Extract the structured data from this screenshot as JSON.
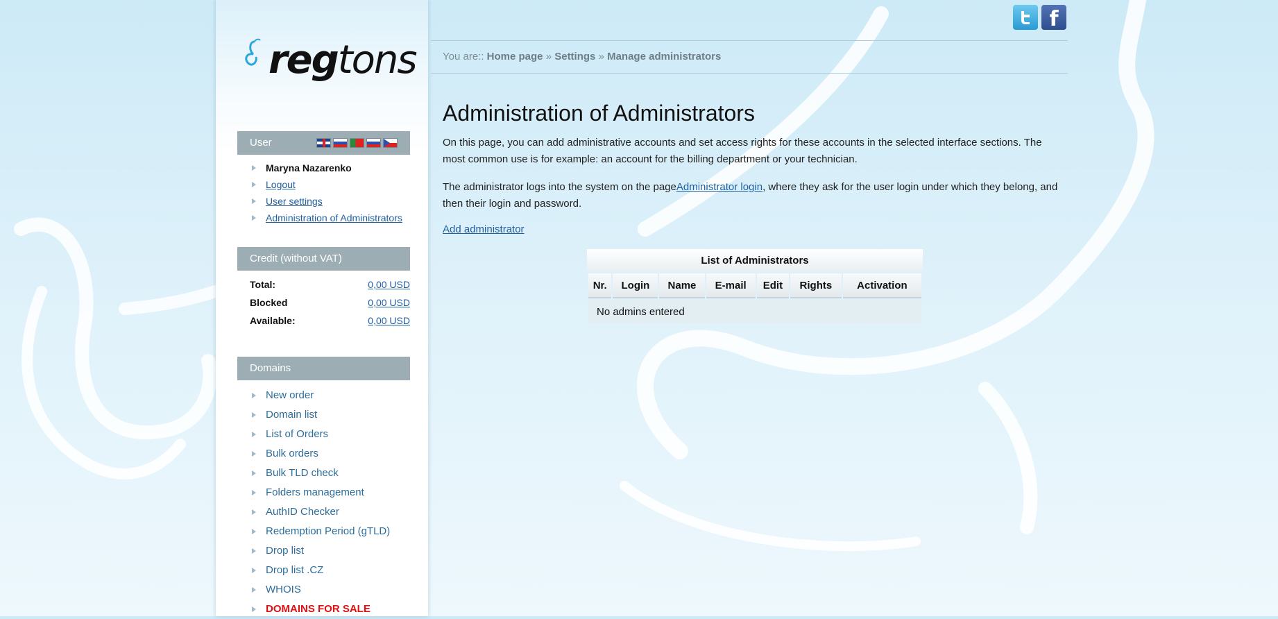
{
  "brand": {
    "logo_bold": "reg",
    "logo_light": "tons"
  },
  "social": {
    "twitter": "twitter-icon",
    "facebook": "facebook-icon",
    "facebook_glyph": "f"
  },
  "breadcrumb": {
    "prefix": "You are:: ",
    "items": [
      "Home page",
      "Settings",
      "Manage administrators"
    ],
    "separator": " » "
  },
  "sidebar": {
    "user_panel": {
      "title": "User",
      "languages": [
        "en",
        "ru",
        "pt",
        "sk",
        "cz"
      ],
      "name": "Maryna Nazarenko",
      "links": [
        "Logout",
        "User settings",
        "Administration of Administrators"
      ]
    },
    "credit_panel": {
      "title": "Credit (without VAT)",
      "rows": [
        {
          "label": "Total:",
          "value": "0,00 USD"
        },
        {
          "label": "Blocked",
          "value": "0,00 USD"
        },
        {
          "label": "Available:",
          "value": "0,00 USD"
        }
      ]
    },
    "domains_panel": {
      "title": "Domains",
      "items": [
        "New order",
        "Domain list",
        "List of Orders",
        "Bulk orders",
        "Bulk TLD check",
        "Folders management",
        "AuthID Checker",
        "Redemption Period (gTLD)",
        "Drop list",
        "Drop list .CZ",
        "WHOIS",
        "DOMAINS FOR SALE"
      ]
    }
  },
  "main": {
    "title": "Administration of Administrators",
    "intro": "On this page, you can add administrative accounts and set access rights for these accounts in the selected interface sections. The most common use is for example: an account for the billing department or your technician.",
    "login_text_before": "The administrator logs into the system on the page",
    "login_link": "Administrator login",
    "login_text_after": ", where they ask for the user login under which they belong, and then their login and password.",
    "add_link": "Add administrator",
    "table": {
      "caption": "List of Administrators",
      "columns": [
        "Nr.",
        "Login",
        "Name",
        "E-mail",
        "Edit",
        "Rights",
        "Activation"
      ],
      "empty_message": "No admins entered"
    }
  },
  "colors": {
    "accent_link": "#1f5fa0",
    "panel_header": "#9cadb4",
    "sale": "#e01010"
  }
}
